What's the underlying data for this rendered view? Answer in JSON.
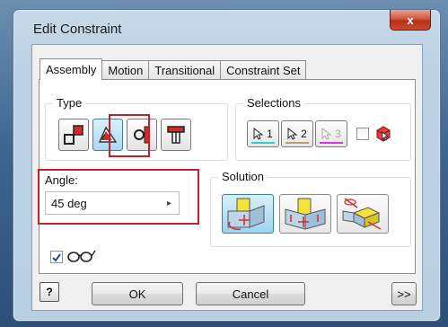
{
  "window": {
    "title": "Edit Constraint",
    "close_label": "x"
  },
  "tabs": [
    {
      "label": "Assembly",
      "active": true
    },
    {
      "label": "Motion",
      "active": false
    },
    {
      "label": "Transitional",
      "active": false
    },
    {
      "label": "Constraint Set",
      "active": false
    }
  ],
  "type_group": {
    "label": "Type",
    "buttons": [
      {
        "icon": "mate-icon",
        "selected": false
      },
      {
        "icon": "angle-icon",
        "selected": true
      },
      {
        "icon": "tangent-icon",
        "selected": false
      },
      {
        "icon": "insert-icon",
        "selected": false
      }
    ]
  },
  "selections_group": {
    "label": "Selections",
    "buttons": [
      {
        "number": "1",
        "color": "#38c8cf",
        "enabled": true
      },
      {
        "number": "2",
        "color": "#b5a170",
        "enabled": true
      },
      {
        "number": "3",
        "color": "#d23bd2",
        "enabled": false
      }
    ],
    "pick_part_first_checked": false
  },
  "angle": {
    "label": "Angle:",
    "value": "45 deg"
  },
  "solution_group": {
    "label": "Solution",
    "options": [
      {
        "icon": "directed-angle-icon",
        "selected": true
      },
      {
        "icon": "undirected-angle-icon",
        "selected": false
      },
      {
        "icon": "explicit-reference-vector-icon",
        "selected": false
      }
    ]
  },
  "show_preview_checked": true,
  "buttons": {
    "ok": "OK",
    "cancel": "Cancel",
    "more": ">>",
    "help": "?"
  },
  "colors": {
    "highlight_red": "#c0212a",
    "selection_blue": "#3c7fb1"
  }
}
